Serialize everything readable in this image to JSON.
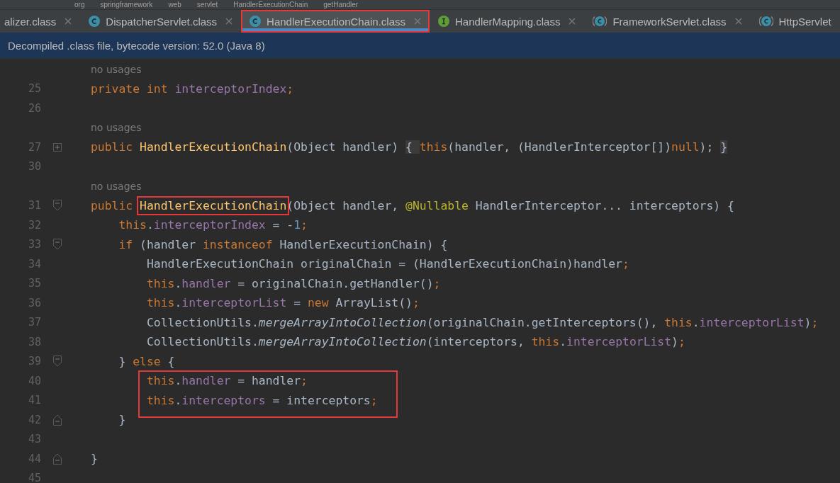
{
  "breadcrumb": [
    "org",
    "springframework",
    "web",
    "servlet",
    "HandlerExecutionChain",
    "getHandler"
  ],
  "tabs": [
    {
      "label": "alizer.class",
      "kind": "plain",
      "selected": false,
      "boxed": false
    },
    {
      "label": "DispatcherServlet.class",
      "kind": "class",
      "selected": false,
      "boxed": false
    },
    {
      "label": "HandlerExecutionChain.class",
      "kind": "class",
      "selected": true,
      "boxed": true
    },
    {
      "label": "HandlerMapping.class",
      "kind": "interface",
      "selected": false,
      "boxed": false
    },
    {
      "label": "FrameworkServlet.class",
      "kind": "abstract",
      "selected": false,
      "boxed": false
    },
    {
      "label": "HttpServlet",
      "kind": "abstract",
      "selected": false,
      "boxed": false
    }
  ],
  "banner": "Decompiled .class file, bytecode version: 52.0 (Java 8)",
  "lines": [
    {
      "hint": "no usages"
    },
    {
      "num": "25",
      "tokens": [
        {
          "t": "private int ",
          "kind": "kw"
        },
        {
          "t": "interceptorIndex",
          "kind": "field"
        },
        {
          "t": ";",
          "kind": "kw"
        }
      ]
    },
    {
      "num": "26"
    },
    {
      "hint": "no usages"
    },
    {
      "num": "27",
      "fold": {
        "kind": "collapsed"
      },
      "tokens": [
        {
          "t": "public ",
          "kind": "kw"
        },
        {
          "t": "HandlerExecutionChain",
          "kind": "decl"
        },
        {
          "t": "(Object handler) ",
          "kind": "plain"
        },
        {
          "t": "{ ",
          "kind": "fold"
        },
        {
          "t": "this",
          "kind": "kw"
        },
        {
          "t": "(handler, (HandlerInterceptor[])",
          "kind": "plain"
        },
        {
          "t": "null",
          "kind": "kw"
        },
        {
          "t": "); ",
          "kind": "plain"
        },
        {
          "t": "}",
          "kind": "fold"
        }
      ]
    },
    {
      "num": "30"
    },
    {
      "hint": "no usages"
    },
    {
      "num": "31",
      "fold": {
        "kind": "open"
      },
      "tokens": [
        {
          "t": "public ",
          "kind": "kw"
        },
        {
          "t": "HandlerExecutionChain",
          "kind": "decl",
          "boxed": true
        },
        {
          "t": "(Object handler, ",
          "kind": "plain"
        },
        {
          "t": "@Nullable",
          "kind": "anno"
        },
        {
          "t": " HandlerInterceptor... interceptors) {",
          "kind": "plain"
        }
      ]
    },
    {
      "num": "32",
      "tokens": [
        {
          "t": "    this",
          "kind": "kw"
        },
        {
          "t": ".",
          "kind": "plain"
        },
        {
          "t": "interceptorIndex",
          "kind": "field"
        },
        {
          "t": " = -",
          "kind": "plain"
        },
        {
          "t": "1",
          "kind": "num"
        },
        {
          "t": ";",
          "kind": "kw"
        }
      ]
    },
    {
      "num": "33",
      "fold": {
        "kind": "open"
      },
      "tokens": [
        {
          "t": "    if ",
          "kind": "kw"
        },
        {
          "t": "(handler ",
          "kind": "plain"
        },
        {
          "t": "instanceof ",
          "kind": "kw"
        },
        {
          "t": "HandlerExecutionChain) {",
          "kind": "plain"
        }
      ]
    },
    {
      "num": "34",
      "tokens": [
        {
          "t": "        HandlerExecutionChain originalChain = (HandlerExecutionChain)handler",
          "kind": "plain"
        },
        {
          "t": ";",
          "kind": "kw"
        }
      ]
    },
    {
      "num": "35",
      "tokens": [
        {
          "t": "        this",
          "kind": "kw"
        },
        {
          "t": ".",
          "kind": "plain"
        },
        {
          "t": "handler",
          "kind": "field"
        },
        {
          "t": " = originalChain.getHandler()",
          "kind": "plain"
        },
        {
          "t": ";",
          "kind": "kw"
        }
      ]
    },
    {
      "num": "36",
      "tokens": [
        {
          "t": "        this",
          "kind": "kw"
        },
        {
          "t": ".",
          "kind": "plain"
        },
        {
          "t": "interceptorList",
          "kind": "field"
        },
        {
          "t": " = ",
          "kind": "plain"
        },
        {
          "t": "new ",
          "kind": "kw"
        },
        {
          "t": "ArrayList()",
          "kind": "plain"
        },
        {
          "t": ";",
          "kind": "kw"
        }
      ]
    },
    {
      "num": "37",
      "tokens": [
        {
          "t": "        CollectionUtils.",
          "kind": "plain"
        },
        {
          "t": "mergeArrayIntoCollection",
          "kind": "static"
        },
        {
          "t": "(originalChain.getInterceptors(), ",
          "kind": "plain"
        },
        {
          "t": "this",
          "kind": "kw"
        },
        {
          "t": ".",
          "kind": "plain"
        },
        {
          "t": "interceptorList",
          "kind": "field"
        },
        {
          "t": ")",
          "kind": "plain"
        },
        {
          "t": ";",
          "kind": "kw"
        }
      ]
    },
    {
      "num": "38",
      "tokens": [
        {
          "t": "        CollectionUtils.",
          "kind": "plain"
        },
        {
          "t": "mergeArrayIntoCollection",
          "kind": "static"
        },
        {
          "t": "(interceptors, ",
          "kind": "plain"
        },
        {
          "t": "this",
          "kind": "kw"
        },
        {
          "t": ".",
          "kind": "plain"
        },
        {
          "t": "interceptorList",
          "kind": "field"
        },
        {
          "t": ")",
          "kind": "plain"
        },
        {
          "t": ";",
          "kind": "kw"
        }
      ]
    },
    {
      "num": "39",
      "fold": {
        "kind": "open"
      },
      "tokens": [
        {
          "t": "    } ",
          "kind": "plain"
        },
        {
          "t": "else ",
          "kind": "kw"
        },
        {
          "t": "{",
          "kind": "plain"
        }
      ]
    },
    {
      "num": "40",
      "boxed": true,
      "tokens": [
        {
          "t": "        this",
          "kind": "kw"
        },
        {
          "t": ".",
          "kind": "plain"
        },
        {
          "t": "handler",
          "kind": "field"
        },
        {
          "t": " = handler",
          "kind": "plain"
        },
        {
          "t": ";",
          "kind": "kw"
        }
      ]
    },
    {
      "num": "41",
      "boxed": true,
      "tokens": [
        {
          "t": "        this",
          "kind": "kw"
        },
        {
          "t": ".",
          "kind": "plain"
        },
        {
          "t": "interceptors",
          "kind": "field"
        },
        {
          "t": " = interceptors",
          "kind": "plain"
        },
        {
          "t": ";",
          "kind": "kw"
        }
      ]
    },
    {
      "num": "42",
      "fold": {
        "kind": "close"
      },
      "tokens": [
        {
          "t": "    }",
          "kind": "plain"
        }
      ]
    },
    {
      "num": "43"
    },
    {
      "num": "44",
      "fold": {
        "kind": "close"
      },
      "tokens": [
        {
          "t": "}",
          "kind": "plain"
        }
      ]
    },
    {
      "num": "45"
    }
  ]
}
